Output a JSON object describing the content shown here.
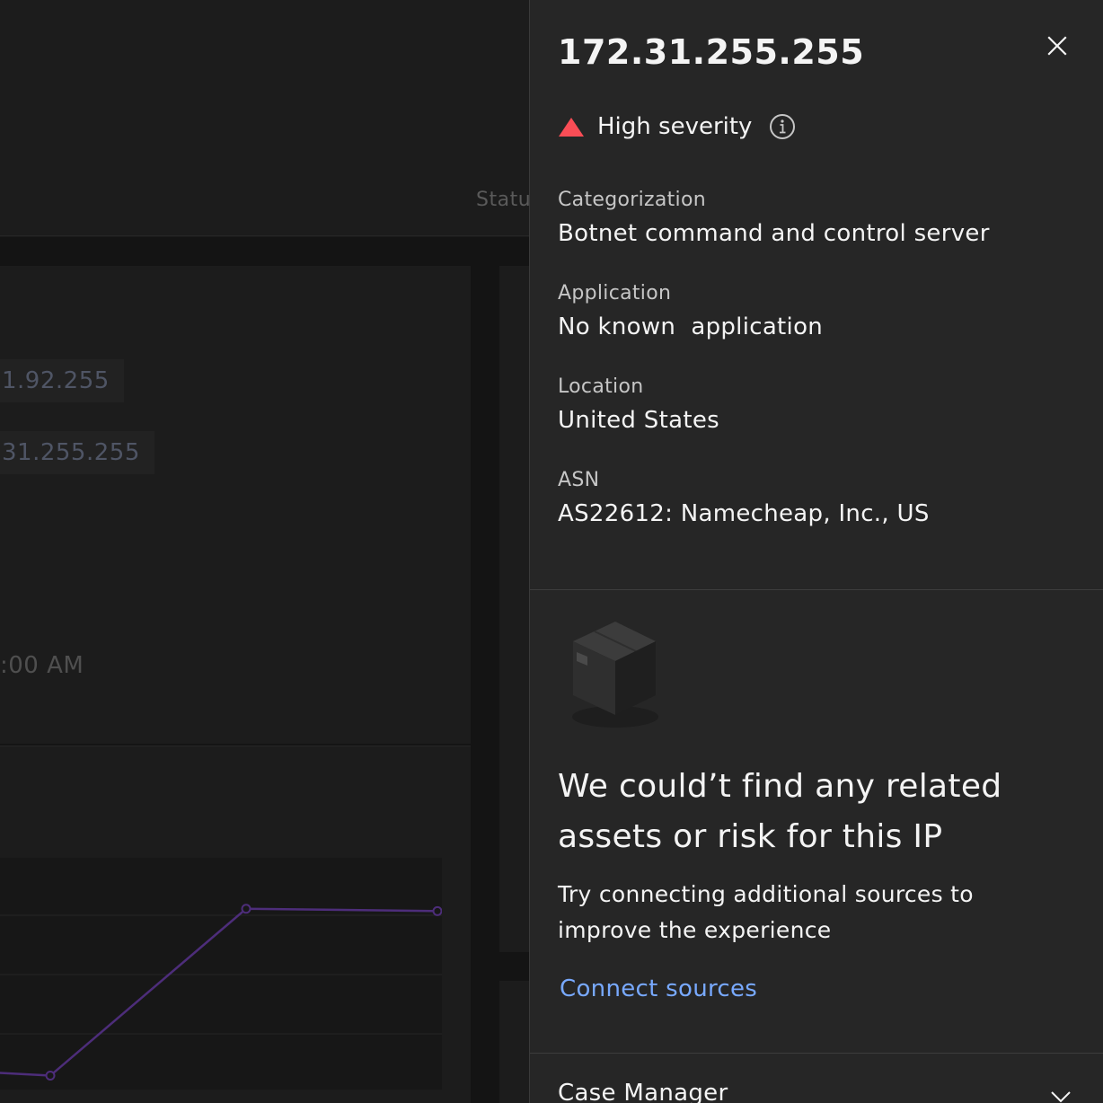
{
  "background": {
    "status_header": "Statu",
    "tags": [
      "1.92.255",
      "31.255.255"
    ],
    "time": ":00 AM",
    "chart_data": {
      "type": "line",
      "series": [
        {
          "values": [
            0.08,
            0.06,
            0.78,
            0.77
          ]
        }
      ],
      "x": [
        0,
        1,
        2,
        3
      ],
      "ylim": [
        0,
        1
      ],
      "grid": true,
      "color": "#4d2d7a"
    }
  },
  "panel": {
    "title": "172.31.255.255",
    "close_icon": "close-icon",
    "severity": {
      "label": "High severity",
      "icon": "warning-triangle-icon",
      "color": "#fa4d56",
      "info_icon": "info-icon"
    },
    "fields": [
      {
        "label": "Categorization",
        "value": "Botnet command and control server"
      },
      {
        "label": "Application",
        "value": "No known  application"
      },
      {
        "label": "Location",
        "value": "United States"
      },
      {
        "label": "ASN",
        "value": "AS22612: Namecheap, Inc., US"
      }
    ],
    "empty_state": {
      "illustration": "empty-box-icon",
      "title": "We could’t find any related assets or risk for this IP",
      "body": "Try connecting additional sources to improve the experience",
      "link": "Connect sources",
      "link_color": "#78a9ff"
    },
    "accordion": {
      "label": "Case Manager",
      "icon": "chevron-down-icon"
    }
  }
}
